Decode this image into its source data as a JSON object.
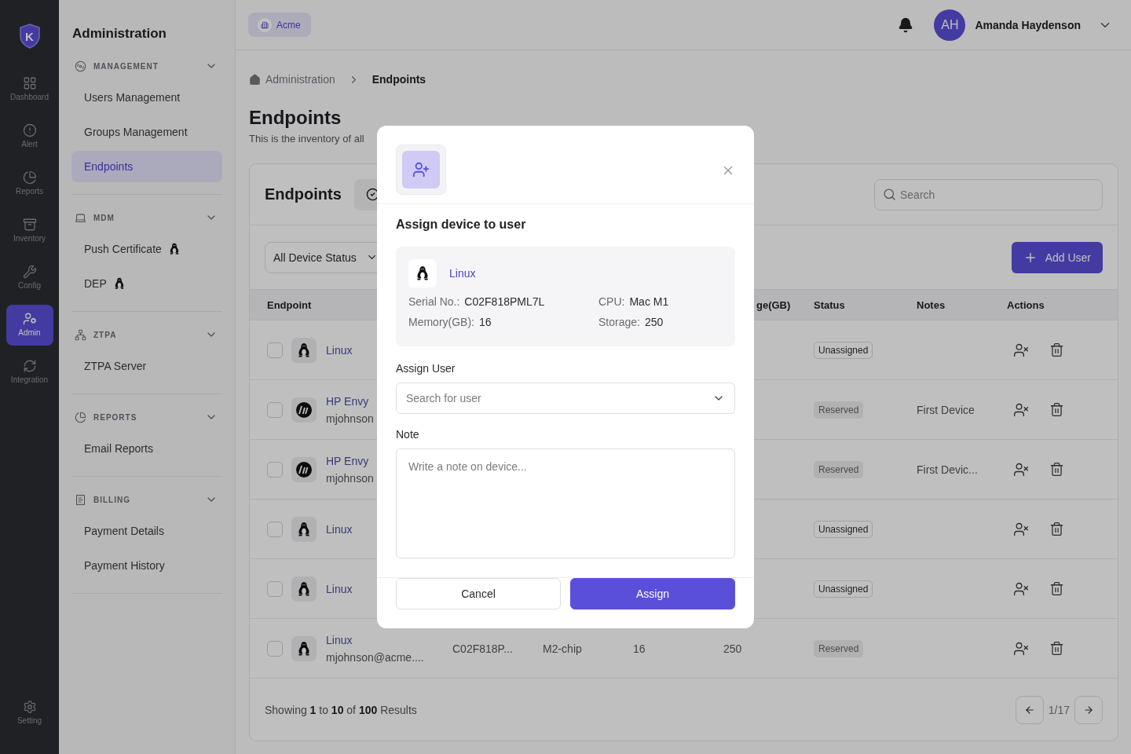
{
  "rail": {
    "logo": "K",
    "items": [
      {
        "label": "Dashboard",
        "kind": "dashboard",
        "selected": false
      },
      {
        "label": "Alert",
        "kind": "alert",
        "selected": false
      },
      {
        "label": "Reports",
        "kind": "reports",
        "selected": false
      },
      {
        "label": "Inventory",
        "kind": "inventory",
        "selected": false
      },
      {
        "label": "Config",
        "kind": "config",
        "selected": false
      },
      {
        "label": "Admin",
        "kind": "admin",
        "selected": true
      },
      {
        "label": "Integration",
        "kind": "integration",
        "selected": false
      }
    ],
    "footer": {
      "label": "Setting",
      "kind": "settings",
      "selected": false
    }
  },
  "panel": {
    "title": "Administration",
    "sections": [
      {
        "title": "MANAGEMENT",
        "kind": "management",
        "expanded": true,
        "items": [
          {
            "label": "Users Management",
            "selected": false
          },
          {
            "label": "Groups Management",
            "selected": false
          },
          {
            "label": "Endpoints",
            "selected": true
          }
        ]
      },
      {
        "title": "MDM",
        "kind": "mdm",
        "expanded": true,
        "items": [
          {
            "label": "Push Certificate",
            "selected": false,
            "kind": "linux"
          },
          {
            "label": "DEP",
            "selected": false,
            "kind": "linux"
          }
        ]
      },
      {
        "title": "ZTPA",
        "kind": "ztpa",
        "expanded": true,
        "items": [
          {
            "label": "ZTPA Server",
            "selected": false
          }
        ]
      },
      {
        "title": "REPORTS",
        "kind": "reports",
        "expanded": true,
        "items": [
          {
            "label": "Email Reports",
            "selected": false
          }
        ]
      },
      {
        "title": "BILLING",
        "kind": "billing",
        "expanded": true,
        "items": [
          {
            "label": "Payment Details",
            "selected": false
          },
          {
            "label": "Payment History",
            "selected": false
          }
        ]
      }
    ]
  },
  "header": {
    "org": "Acme",
    "user_initials": "AH",
    "user_name": "Amanda Haydenson"
  },
  "breadcrumb": [
    {
      "label": "Administration",
      "kind": "home"
    },
    {
      "label": "Endpoints",
      "kind": "current"
    }
  ],
  "page": {
    "title": "Endpoints",
    "subtitle": "This is the inventory of all"
  },
  "card": {
    "title": "Endpoints",
    "search_placeholder": "Search",
    "filter": "All Device Status",
    "add_button": "Add User"
  },
  "table": {
    "columns": [
      {
        "label": "Endpoint",
        "kind": "endpoint"
      },
      {
        "label": "ge(GB)",
        "kind": "storage"
      },
      {
        "label": "Status",
        "kind": "status"
      },
      {
        "label": "Notes",
        "kind": "notes"
      },
      {
        "label": "Actions",
        "kind": "actions"
      }
    ],
    "rows": [
      {
        "checked": false,
        "kind": "linux",
        "name": "Linux",
        "status": {
          "label": "Unassigned",
          "kind": "unassigned"
        }
      },
      {
        "checked": false,
        "kind": "hp",
        "name": "HP Envy",
        "email": "mjohnson",
        "status": {
          "label": "Reserved",
          "kind": "reserved"
        },
        "notes": "First Device"
      },
      {
        "checked": false,
        "kind": "hp",
        "name": "HP Envy",
        "email": "mjohnson",
        "status": {
          "label": "Reserved",
          "kind": "reserved"
        },
        "notes": "First Devic..."
      },
      {
        "checked": false,
        "kind": "linux",
        "name": "Linux",
        "status": {
          "label": "Unassigned",
          "kind": "unassigned"
        }
      },
      {
        "checked": false,
        "kind": "linux",
        "name": "Linux",
        "status": {
          "label": "Unassigned",
          "kind": "unassigned"
        }
      },
      {
        "checked": false,
        "kind": "linux",
        "name": "Linux",
        "email": "mjohnson@acme....",
        "serial": "C02F818P...",
        "cpu": "M2-chip",
        "memory": "16",
        "storage": "250",
        "status": {
          "label": "Reserved",
          "kind": "reserved"
        }
      }
    ]
  },
  "footer": {
    "summary": "Showing **1** to **10** of **100** Results",
    "page": "1/17"
  },
  "modal": {
    "title": "Assign device to user",
    "device": {
      "kind": "linux",
      "name": "Linux",
      "specs": [
        {
          "label": "Serial No.:",
          "value": "C02F818PML7L"
        },
        {
          "label": "CPU:",
          "value": "Mac M1"
        },
        {
          "label": "Memory(GB):",
          "value": "16"
        },
        {
          "label": "Storage:",
          "value": "250"
        }
      ]
    },
    "user_label": "Assign User",
    "user_placeholder": "Search for user",
    "note_label": "Note",
    "note_placeholder": "Write a note on device...",
    "cancel": "Cancel",
    "confirm": "Assign"
  }
}
